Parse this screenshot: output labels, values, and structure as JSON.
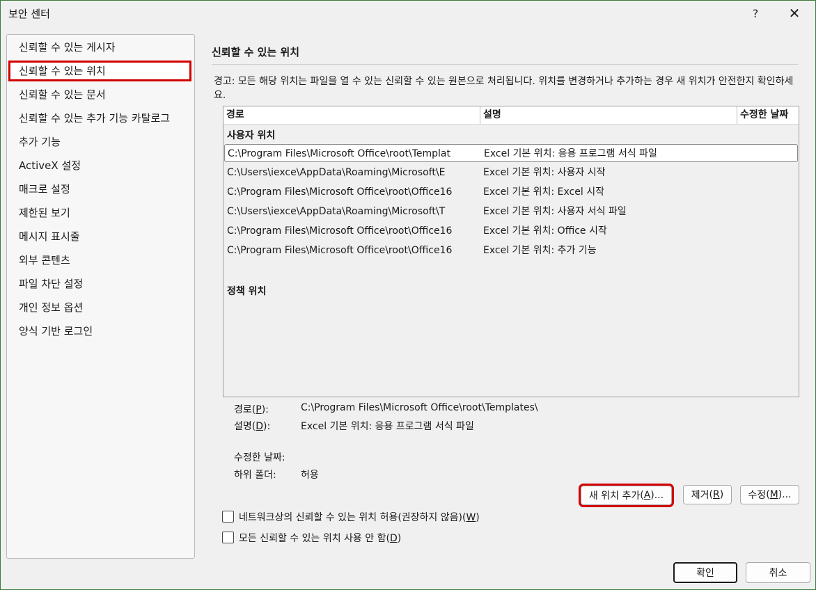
{
  "window": {
    "title": "보안 센터",
    "help_glyph": "?",
    "close_glyph": "✕"
  },
  "sidebar": {
    "items": [
      {
        "label": "신뢰할 수 있는 게시자"
      },
      {
        "label": "신뢰할 수 있는 위치"
      },
      {
        "label": "신뢰할 수 있는 문서"
      },
      {
        "label": "신뢰할 수 있는 추가 기능 카탈로그"
      },
      {
        "label": "추가 기능"
      },
      {
        "label": "ActiveX 설정"
      },
      {
        "label": "매크로 설정"
      },
      {
        "label": "제한된 보기"
      },
      {
        "label": "메시지 표시줄"
      },
      {
        "label": "외부 콘텐츠"
      },
      {
        "label": "파일 차단 설정"
      },
      {
        "label": "개인 정보 옵션"
      },
      {
        "label": "양식 기반 로그인"
      }
    ],
    "selected_index": 1
  },
  "main": {
    "section_title": "신뢰할 수 있는 위치",
    "warning": "경고: 모든 해당 위치는 파일을 열 수 있는 신뢰할 수 있는 원본으로 처리됩니다. 위치를 변경하거나 추가하는 경우 새 위치가 안전한지 확인하세요.",
    "columns": {
      "path": "경로",
      "desc": "설명",
      "modified": "수정한 날짜"
    },
    "user_group": "사용자 위치",
    "rows": [
      {
        "path": "C:\\Program Files\\Microsoft Office\\root\\Templat",
        "desc": "Excel 기본 위치: 응용 프로그램 서식 파일"
      },
      {
        "path": "C:\\Users\\iexce\\AppData\\Roaming\\Microsoft\\E",
        "desc": "Excel 기본 위치: 사용자 시작"
      },
      {
        "path": "C:\\Program Files\\Microsoft Office\\root\\Office16",
        "desc": "Excel 기본 위치: Excel 시작"
      },
      {
        "path": "C:\\Users\\iexce\\AppData\\Roaming\\Microsoft\\T",
        "desc": "Excel 기본 위치: 사용자 서식 파일"
      },
      {
        "path": "C:\\Program Files\\Microsoft Office\\root\\Office16",
        "desc": "Excel 기본 위치: Office 시작"
      },
      {
        "path": "C:\\Program Files\\Microsoft Office\\root\\Office16",
        "desc": "Excel 기본 위치: 추가 기능"
      }
    ],
    "selected_row": 0,
    "policy_group": "정책 위치",
    "details": {
      "path_label": "경로",
      "path_key": "P",
      "path_value": "C:\\Program Files\\Microsoft Office\\root\\Templates\\",
      "desc_label": "설명",
      "desc_key": "D",
      "desc_value": "Excel 기본 위치: 응용 프로그램 서식 파일",
      "modified_label": "수정한 날짜:",
      "subfolder_label": "하위 폴더:",
      "subfolder_value": "허용"
    },
    "buttons": {
      "add": {
        "label": "새 위치 추가",
        "key": "A",
        "suffix": "..."
      },
      "remove": {
        "label": "제거",
        "key": "R",
        "suffix": ""
      },
      "modify": {
        "label": "수정",
        "key": "M",
        "suffix": "..."
      }
    },
    "checkboxes": [
      {
        "label": "네트워크상의 신뢰할 수 있는 위치 허용(권장하지 않음)",
        "key": "W",
        "checked": false
      },
      {
        "label": "모든 신뢰할 수 있는 위치 사용 안 함",
        "key": "D",
        "checked": false
      }
    ]
  },
  "footer": {
    "ok": "확인",
    "cancel": "취소"
  },
  "colors": {
    "highlight": "#d20000",
    "window_border": "#3a7a3a"
  }
}
